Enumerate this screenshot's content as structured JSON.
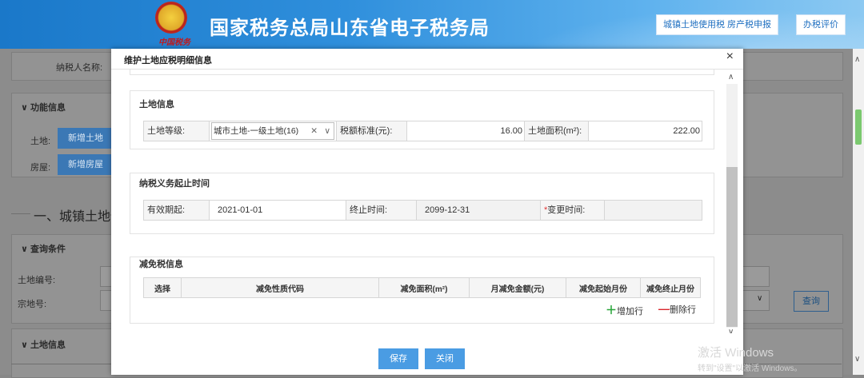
{
  "header": {
    "emblem_script": "中国税务",
    "site_title": "国家税务总局山东省电子税务局",
    "btn_land_tax": "城镇土地使用税 房产税申报",
    "btn_rating": "办税评价"
  },
  "background": {
    "taxpayer_label": "纳税人名称:",
    "func_info": "功能信息",
    "land_label": "土地:",
    "add_land_btn": "新增土地",
    "house_label": "房屋:",
    "add_house_btn": "新增房屋",
    "section_heading": "一、城镇土地使",
    "query_cond": "查询条件",
    "land_no_label": "土地编号:",
    "parcel_no_label": "宗地号:",
    "query_btn": "查询",
    "land_info": "土地信息"
  },
  "modal": {
    "title": "维护土地应税明细信息",
    "close": "×",
    "land_section": {
      "title": "土地信息",
      "grade_label": "土地等级:",
      "grade_value": "城市土地-一级土地(16)",
      "rate_label": "税额标准(元):",
      "rate_value": "16.00",
      "area_label": "土地面积(m²):",
      "area_value": "222.00"
    },
    "period_section": {
      "title": "纳税义务起止时间",
      "start_label": "有效期起:",
      "start_value": "2021-01-01",
      "end_label": "终止时间:",
      "end_value": "2099-12-31",
      "change_req": "*",
      "change_label": "变更时间:",
      "change_value": ""
    },
    "relief_section": {
      "title": "减免税信息",
      "columns": [
        "选择",
        "减免性质代码",
        "减免面积(m²)",
        "月减免金额(元)",
        "减免起始月份",
        "减免终止月份"
      ],
      "add_row": "增加行",
      "del_row": "删除行"
    },
    "footer": {
      "save": "保存",
      "close": "关闭"
    }
  },
  "watermark": {
    "line1": "激活 Windows",
    "line2": "转到\"设置\"以激活 Windows。"
  },
  "colors": {
    "header_blue": "#1a78c9",
    "button_blue": "#4a9ce3",
    "add_green": "#2aa53a",
    "delete_red": "#d9262c"
  }
}
